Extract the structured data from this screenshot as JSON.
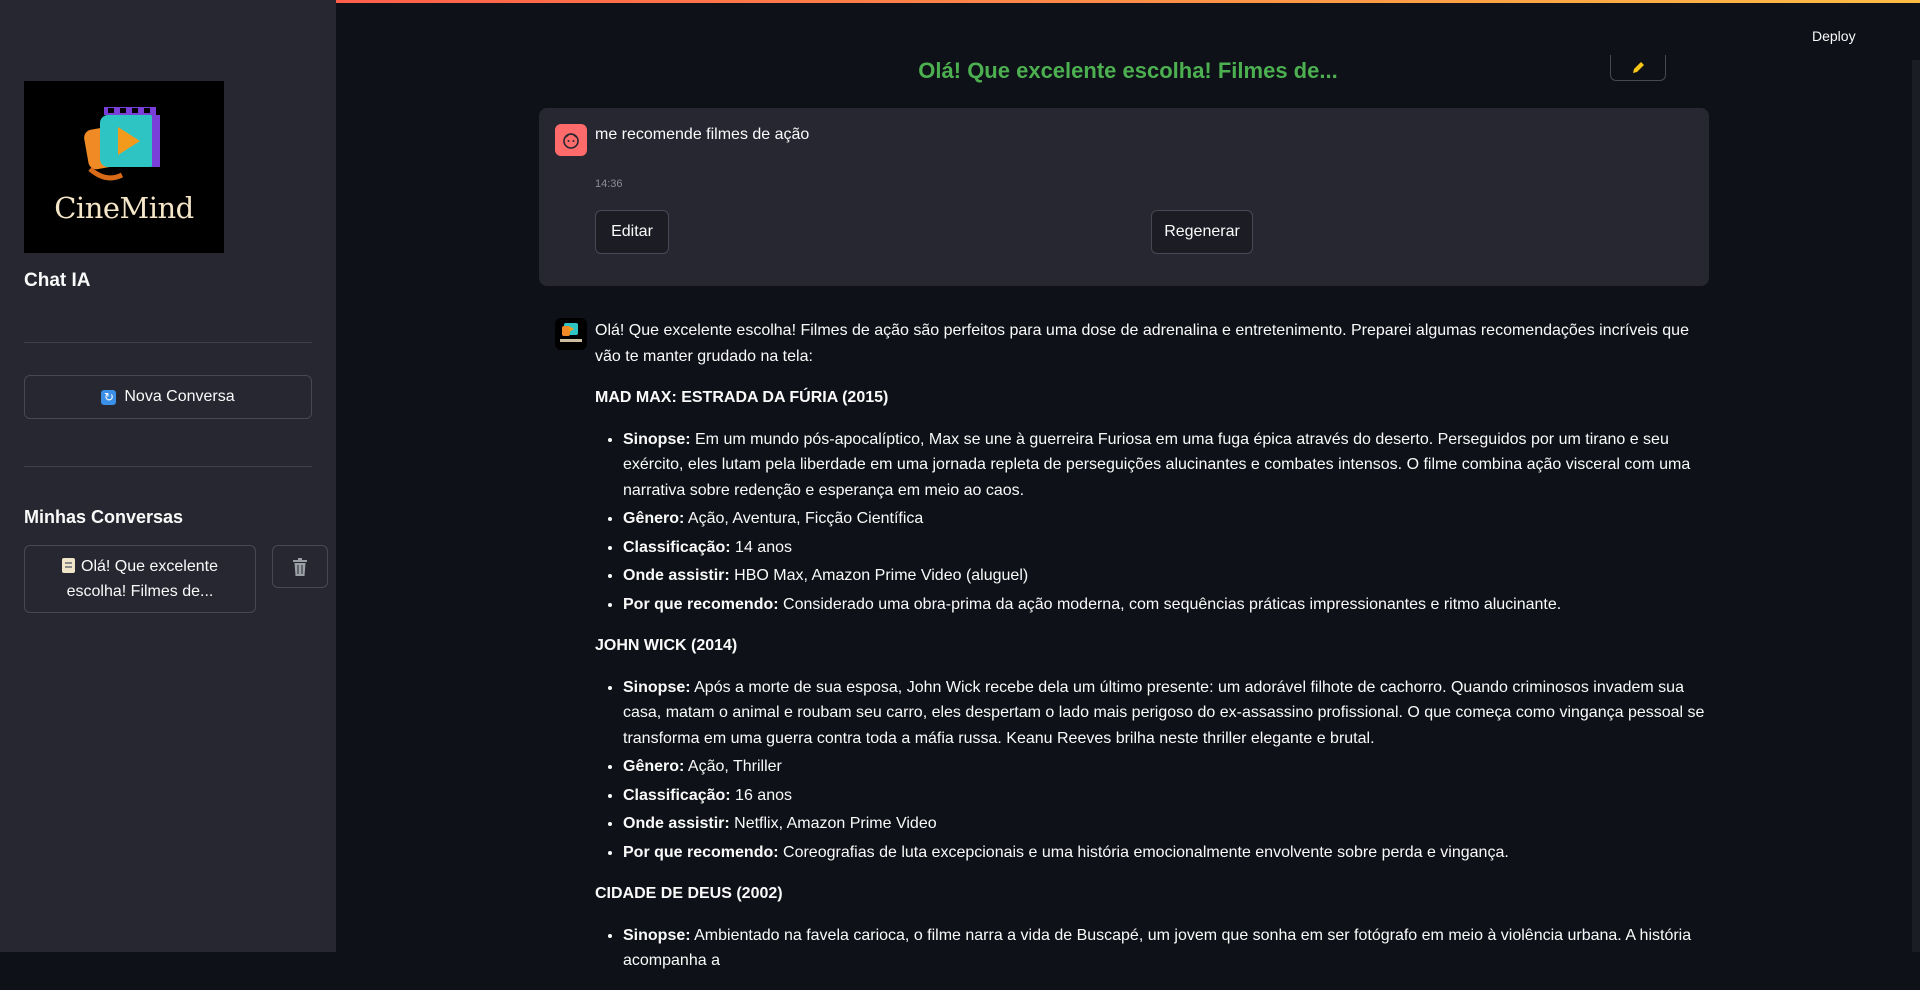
{
  "header": {
    "deploy_label": "Deploy"
  },
  "sidebar": {
    "logo_text": "CineMind",
    "title": "Chat IA",
    "new_chat_label": "Nova Conversa",
    "conversations_title": "Minhas Conversas",
    "conversations": [
      {
        "title": "Olá! Que excelente escolha! Filmes de..."
      }
    ]
  },
  "main": {
    "title": "Olá! Que excelente escolha! Filmes de...",
    "user_message": {
      "text": "me recomende filmes de ação",
      "time": "14:36",
      "edit_label": "Editar",
      "regenerate_label": "Regenerar"
    },
    "assistant": {
      "intro": "Olá! Que excelente escolha! Filmes de ação são perfeitos para uma dose de adrenalina e entretenimento. Preparei algumas recomendações incríveis que vão te manter grudado na tela:",
      "movies": [
        {
          "title": "MAD MAX: ESTRADA DA FÚRIA (2015)",
          "items": [
            {
              "label": "Sinopse:",
              "text": " Em um mundo pós-apocalíptico, Max se une à guerreira Furiosa em uma fuga épica através do deserto. Perseguidos por um tirano e seu exército, eles lutam pela liberdade em uma jornada repleta de perseguições alucinantes e combates intensos. O filme combina ação visceral com uma narrativa sobre redenção e esperança em meio ao caos."
            },
            {
              "label": "Gênero:",
              "text": " Ação, Aventura, Ficção Científica"
            },
            {
              "label": "Classificação:",
              "text": " 14 anos"
            },
            {
              "label": "Onde assistir:",
              "text": " HBO Max, Amazon Prime Video (aluguel)"
            },
            {
              "label": "Por que recomendo:",
              "text": " Considerado uma obra-prima da ação moderna, com sequências práticas impressionantes e ritmo alucinante."
            }
          ]
        },
        {
          "title": "JOHN WICK (2014)",
          "items": [
            {
              "label": "Sinopse:",
              "text": " Após a morte de sua esposa, John Wick recebe dela um último presente: um adorável filhote de cachorro. Quando criminosos invadem sua casa, matam o animal e roubam seu carro, eles despertam o lado mais perigoso do ex-assassino profissional. O que começa como vingança pessoal se transforma em uma guerra contra toda a máfia russa. Keanu Reeves brilha neste thriller elegante e brutal."
            },
            {
              "label": "Gênero:",
              "text": " Ação, Thriller"
            },
            {
              "label": "Classificação:",
              "text": " 16 anos"
            },
            {
              "label": "Onde assistir:",
              "text": " Netflix, Amazon Prime Video"
            },
            {
              "label": "Por que recomendo:",
              "text": " Coreografias de luta excepcionais e uma história emocionalmente envolvente sobre perda e vingança."
            }
          ]
        },
        {
          "title": "CIDADE DE DEUS (2002)",
          "items": [
            {
              "label": "Sinopse:",
              "text": " Ambientado na favela carioca, o filme narra a vida de Buscapé, um jovem que sonha em ser fotógrafo em meio à violência urbana. A história acompanha a"
            }
          ]
        }
      ]
    }
  }
}
